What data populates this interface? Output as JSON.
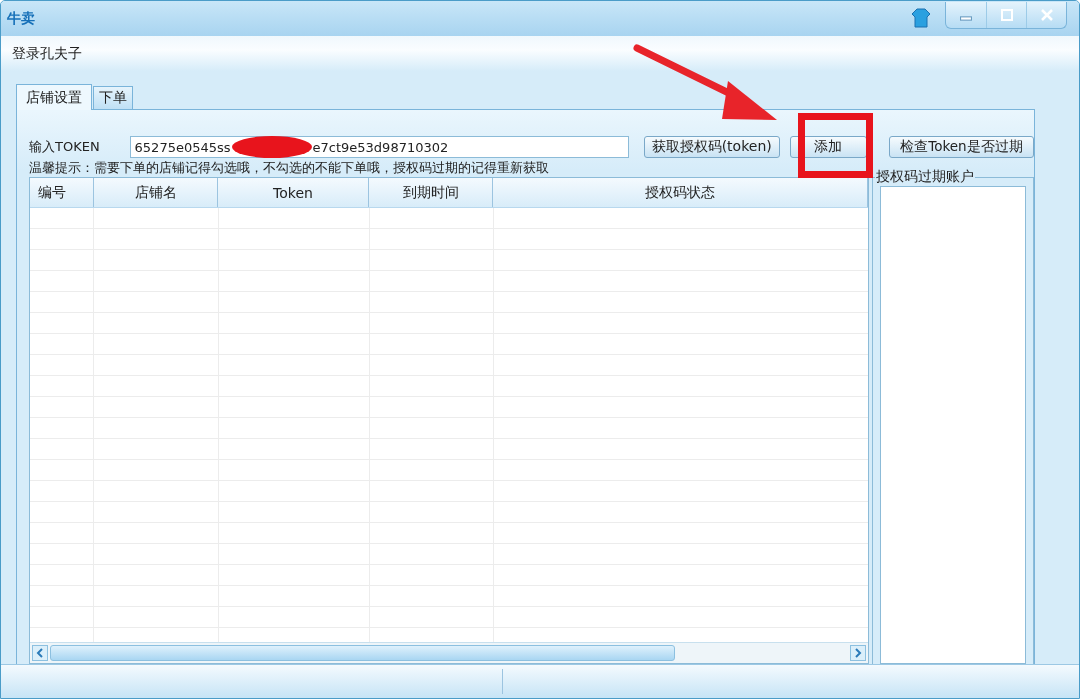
{
  "window": {
    "title": "牛卖"
  },
  "menu": {
    "label": "登录孔夫子"
  },
  "tabs": [
    {
      "label": "店铺设置",
      "selected": true
    },
    {
      "label": "下单",
      "selected": false
    }
  ],
  "token_input": {
    "label": "输入TOKEN",
    "value_start": "65275e0545ss",
    "value_end": "e7ct9e53d98710302",
    "redacted": true
  },
  "buttons": [
    {
      "label": "获取授权码(token)",
      "highlighted": false
    },
    {
      "label": "添加",
      "highlighted": true
    },
    {
      "label": "检查Token是否过期",
      "highlighted": false
    }
  ],
  "hint": "温馨提示：需要下单的店铺记得勾选哦，不勾选的不能下单哦，授权码过期的记得重新获取",
  "table": {
    "columns": [
      "编号",
      "店铺名",
      "Token",
      "到期时间",
      "授权码状态"
    ]
  },
  "expired_accounts": {
    "title": "授权码过期账户"
  },
  "annotation": {
    "arrow": true
  }
}
